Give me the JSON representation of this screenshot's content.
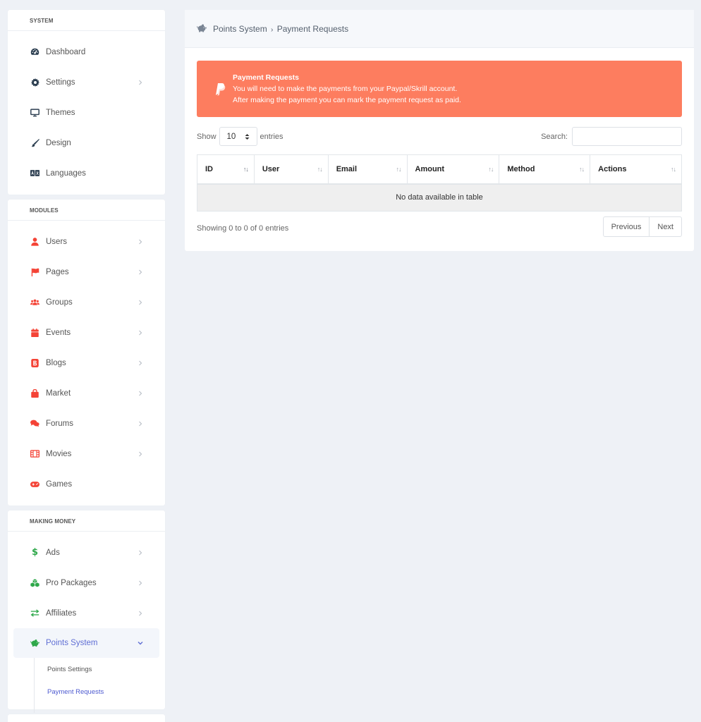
{
  "sidebar": {
    "system": {
      "title": "SYSTEM",
      "items": [
        {
          "label": "Dashboard",
          "icon": "dashboard-icon",
          "color": "#2c3e50"
        },
        {
          "label": "Settings",
          "icon": "gear-icon",
          "color": "#2c3e50"
        },
        {
          "label": "Themes",
          "icon": "monitor-icon",
          "color": "#2c3e50"
        },
        {
          "label": "Design",
          "icon": "paintbrush-icon",
          "color": "#2c3e50"
        },
        {
          "label": "Languages",
          "icon": "language-icon",
          "color": "#2c3e50"
        }
      ]
    },
    "modules": {
      "title": "MODULES",
      "items": [
        {
          "label": "Users",
          "icon": "user-icon",
          "color": "#f44336"
        },
        {
          "label": "Pages",
          "icon": "flag-icon",
          "color": "#f44336"
        },
        {
          "label": "Groups",
          "icon": "users-icon",
          "color": "#f44336"
        },
        {
          "label": "Events",
          "icon": "calendar-icon",
          "color": "#f44336"
        },
        {
          "label": "Blogs",
          "icon": "blog-icon",
          "color": "#f44336"
        },
        {
          "label": "Market",
          "icon": "shopping-bag-icon",
          "color": "#f44336"
        },
        {
          "label": "Forums",
          "icon": "comments-icon",
          "color": "#f44336"
        },
        {
          "label": "Movies",
          "icon": "film-icon",
          "color": "#f44336"
        },
        {
          "label": "Games",
          "icon": "gamepad-icon",
          "color": "#f44336"
        }
      ]
    },
    "money": {
      "title": "MAKING MONEY",
      "items": [
        {
          "label": "Ads",
          "icon": "dollar-icon",
          "color": "#2ea84a"
        },
        {
          "label": "Pro Packages",
          "icon": "cubes-icon",
          "color": "#2ea84a"
        },
        {
          "label": "Affiliates",
          "icon": "exchange-icon",
          "color": "#2ea84a"
        },
        {
          "label": "Points System",
          "icon": "piggy-bank-icon",
          "color": "#2ea84a"
        }
      ],
      "subitems": [
        {
          "label": "Points Settings"
        },
        {
          "label": "Payment Requests"
        }
      ]
    }
  },
  "header": {
    "icon": "piggy-bank-icon",
    "section": "Points System",
    "separator": "›",
    "page": "Payment Requests"
  },
  "alert": {
    "icon": "paypal-icon",
    "title": "Payment Requests",
    "line1": "You will need to make the payments from your Paypal/Skrill account.",
    "line2": "After making the payment you can mark the payment request as paid.",
    "color": "#fd7d5f"
  },
  "table_controls": {
    "show_label": "Show",
    "page_size": "10",
    "entries_label": "entries",
    "search_label": "Search:",
    "search_value": ""
  },
  "table": {
    "columns": [
      "ID",
      "User",
      "Email",
      "Amount",
      "Method",
      "Actions"
    ],
    "empty_text": "No data available in table"
  },
  "footer": {
    "info": "Showing 0 to 0 of 0 entries",
    "previous": "Previous",
    "next": "Next"
  }
}
